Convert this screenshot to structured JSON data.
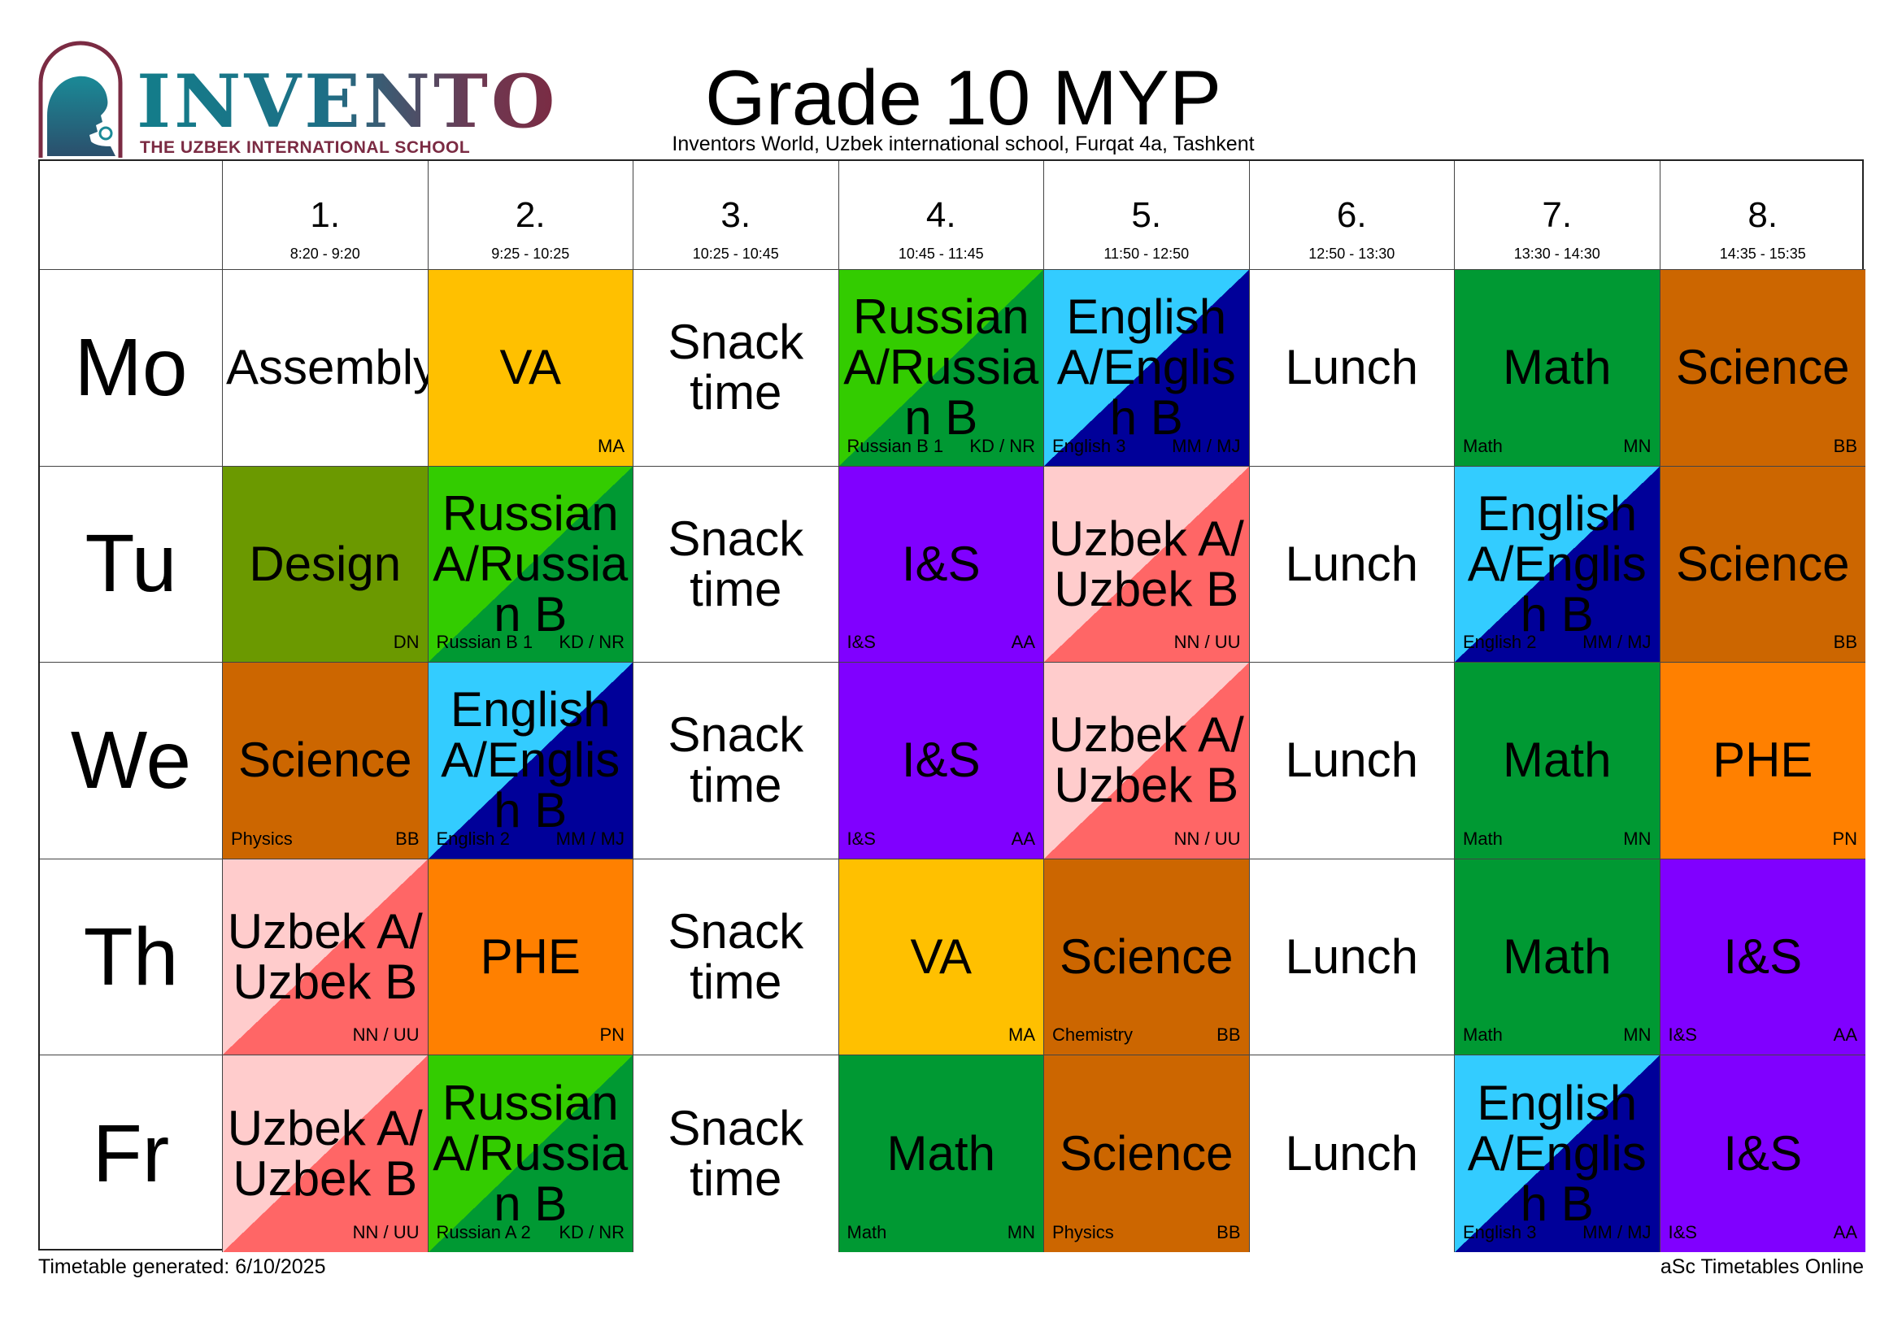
{
  "header": {
    "logo_brand": "INVENTO",
    "logo_tagline": "THE UZBEK INTERNATIONAL SCHOOL",
    "title": "Grade 10 MYP",
    "subtitle": "Inventors World, Uzbek international school, Furqat 4a, Tashkent"
  },
  "colors": {
    "white": "#ffffff",
    "yellow": "#ffc000",
    "olive": "#6b9900",
    "brown": "#cc6600",
    "green": "#009933",
    "purple": "#8000ff",
    "orange": "#ff8000",
    "lightgreen": "#33cc00",
    "lightblue": "#33ccff",
    "navy": "#000099",
    "pink": "#ffcccc",
    "salmon": "#ff6666"
  },
  "periods": [
    {
      "num": "1.",
      "time": "8:20 - 9:20"
    },
    {
      "num": "2.",
      "time": "9:25 - 10:25"
    },
    {
      "num": "3.",
      "time": "10:25 - 10:45"
    },
    {
      "num": "4.",
      "time": "10:45 - 11:45"
    },
    {
      "num": "5.",
      "time": "11:50 - 12:50"
    },
    {
      "num": "6.",
      "time": "12:50 - 13:30"
    },
    {
      "num": "7.",
      "time": "13:30 - 14:30"
    },
    {
      "num": "8.",
      "time": "14:35 - 15:35"
    }
  ],
  "days": [
    {
      "label": "Mo",
      "lessons": [
        {
          "name": "Assembly",
          "bg": "white",
          "left": "",
          "right": ""
        },
        {
          "name": "VA",
          "bg": "yellow",
          "left": "",
          "right": "MA"
        },
        {
          "name": "Snack time",
          "bg": "white",
          "left": "",
          "right": ""
        },
        {
          "name": "Russian A/Russian B",
          "bg": "lightgreen",
          "bg2": "green",
          "left": "Russian B 1",
          "right": "KD / NR"
        },
        {
          "name": "English A/English B",
          "bg": "lightblue",
          "bg2": "navy",
          "left": "English 3",
          "right": "MM / MJ"
        },
        {
          "name": "Lunch",
          "bg": "white",
          "left": "",
          "right": ""
        },
        {
          "name": "Math",
          "bg": "green",
          "left": "Math",
          "right": "MN"
        },
        {
          "name": "Science",
          "bg": "brown",
          "left": "",
          "right": "BB"
        }
      ]
    },
    {
      "label": "Tu",
      "lessons": [
        {
          "name": "Design",
          "bg": "olive",
          "left": "",
          "right": "DN"
        },
        {
          "name": "Russian A/Russian B",
          "bg": "lightgreen",
          "bg2": "green",
          "left": "Russian B 1",
          "right": "KD / NR"
        },
        {
          "name": "Snack time",
          "bg": "white",
          "left": "",
          "right": ""
        },
        {
          "name": "I&S",
          "bg": "purple",
          "left": "I&S",
          "right": "AA"
        },
        {
          "name": "Uzbek A/Uzbek B",
          "bg": "pink",
          "bg2": "salmon",
          "left": "",
          "right": "NN / UU"
        },
        {
          "name": "Lunch",
          "bg": "white",
          "left": "",
          "right": ""
        },
        {
          "name": "English A/English B",
          "bg": "lightblue",
          "bg2": "navy",
          "left": "English 2",
          "right": "MM / MJ"
        },
        {
          "name": "Science",
          "bg": "brown",
          "left": "",
          "right": "BB"
        }
      ]
    },
    {
      "label": "We",
      "lessons": [
        {
          "name": "Science",
          "bg": "brown",
          "left": "Physics",
          "right": "BB"
        },
        {
          "name": "English A/English B",
          "bg": "lightblue",
          "bg2": "navy",
          "left": "English 2",
          "right": "MM / MJ"
        },
        {
          "name": "Snack time",
          "bg": "white",
          "left": "",
          "right": ""
        },
        {
          "name": "I&S",
          "bg": "purple",
          "left": "I&S",
          "right": "AA"
        },
        {
          "name": "Uzbek A/Uzbek B",
          "bg": "pink",
          "bg2": "salmon",
          "left": "",
          "right": "NN / UU"
        },
        {
          "name": "Lunch",
          "bg": "white",
          "left": "",
          "right": ""
        },
        {
          "name": "Math",
          "bg": "green",
          "left": "Math",
          "right": "MN"
        },
        {
          "name": "PHE",
          "bg": "orange",
          "left": "",
          "right": "PN"
        }
      ]
    },
    {
      "label": "Th",
      "lessons": [
        {
          "name": "Uzbek A/Uzbek B",
          "bg": "pink",
          "bg2": "salmon",
          "left": "",
          "right": "NN / UU"
        },
        {
          "name": "PHE",
          "bg": "orange",
          "left": "",
          "right": "PN"
        },
        {
          "name": "Snack time",
          "bg": "white",
          "left": "",
          "right": ""
        },
        {
          "name": "VA",
          "bg": "yellow",
          "left": "",
          "right": "MA"
        },
        {
          "name": "Science",
          "bg": "brown",
          "left": "Chemistry",
          "right": "BB"
        },
        {
          "name": "Lunch",
          "bg": "white",
          "left": "",
          "right": ""
        },
        {
          "name": "Math",
          "bg": "green",
          "left": "Math",
          "right": "MN"
        },
        {
          "name": "I&S",
          "bg": "purple",
          "left": "I&S",
          "right": "AA"
        }
      ]
    },
    {
      "label": "Fr",
      "lessons": [
        {
          "name": "Uzbek A/Uzbek B",
          "bg": "pink",
          "bg2": "salmon",
          "left": "",
          "right": "NN / UU"
        },
        {
          "name": "Russian A/Russian B",
          "bg": "lightgreen",
          "bg2": "green",
          "left": "Russian A 2",
          "right": "KD / NR"
        },
        {
          "name": "Snack time",
          "bg": "white",
          "left": "",
          "right": ""
        },
        {
          "name": "Math",
          "bg": "green",
          "left": "Math",
          "right": "MN"
        },
        {
          "name": "Science",
          "bg": "brown",
          "left": "Physics",
          "right": "BB"
        },
        {
          "name": "Lunch",
          "bg": "white",
          "left": "",
          "right": ""
        },
        {
          "name": "English A/English B",
          "bg": "lightblue",
          "bg2": "navy",
          "left": "English 3",
          "right": "MM / MJ"
        },
        {
          "name": "I&S",
          "bg": "purple",
          "left": "I&S",
          "right": "AA"
        }
      ]
    }
  ],
  "footer": {
    "generated": "Timetable generated: 6/10/2025",
    "credit": "aSc Timetables Online"
  }
}
